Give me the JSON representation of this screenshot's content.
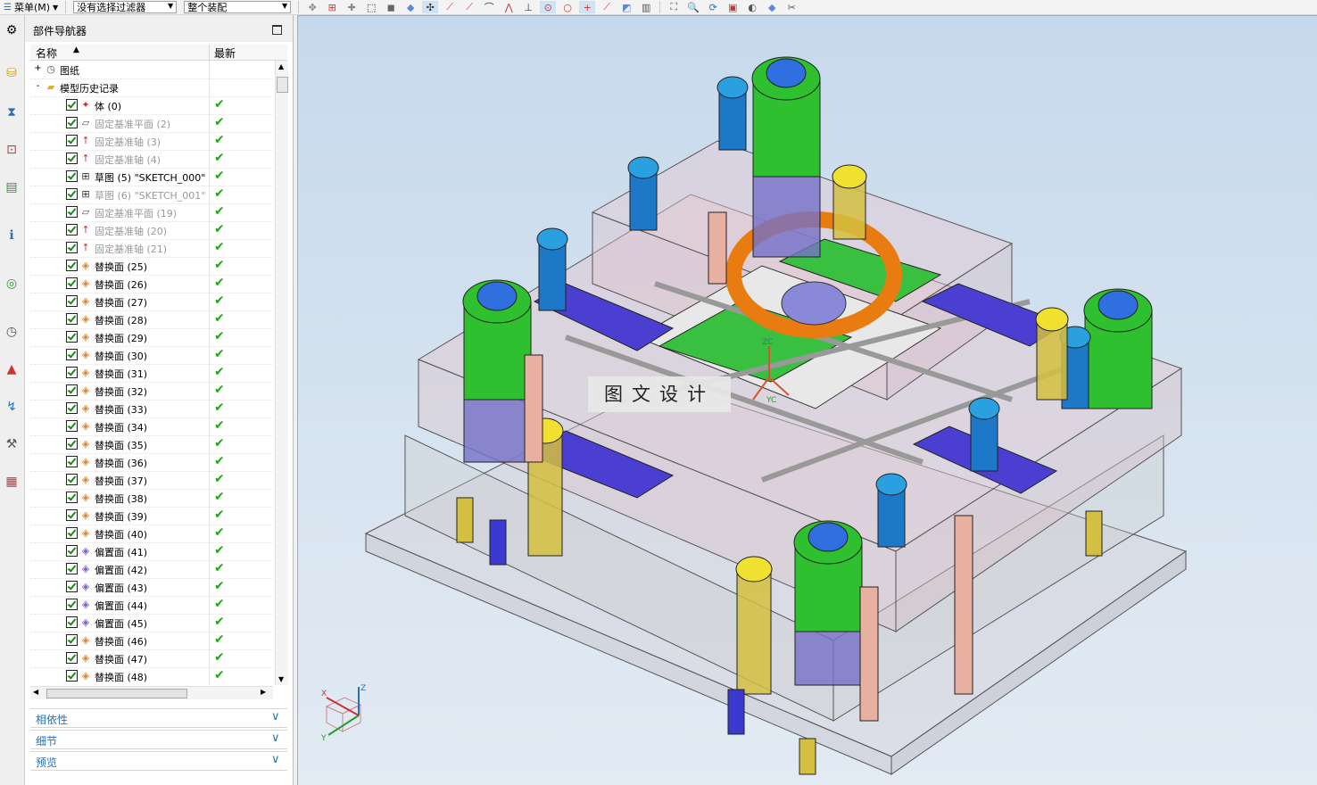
{
  "toolbar": {
    "menu_label": "菜单(M)",
    "filter_value": "没有选择过滤器",
    "scope_value": "整个装配"
  },
  "navigator": {
    "title": "部件导航器",
    "col_name": "名称",
    "col_latest": "最新",
    "tree": [
      {
        "label": "图纸",
        "level": 0,
        "expand": "+",
        "checked": false,
        "icon": "drawing-icon",
        "latest": false,
        "dim": false
      },
      {
        "label": "模型历史记录",
        "level": 0,
        "expand": "-",
        "checked": false,
        "icon": "folder-icon",
        "latest": false,
        "dim": false
      },
      {
        "label": "体 (0)",
        "level": 1,
        "checked": true,
        "icon": "body-icon",
        "latest": true,
        "dim": false
      },
      {
        "label": "固定基准平面 (2)",
        "level": 1,
        "checked": true,
        "icon": "datum-plane-icon",
        "latest": true,
        "dim": true
      },
      {
        "label": "固定基准轴 (3)",
        "level": 1,
        "checked": true,
        "icon": "datum-axis-icon",
        "latest": true,
        "dim": true
      },
      {
        "label": "固定基准轴 (4)",
        "level": 1,
        "checked": true,
        "icon": "datum-axis-icon",
        "latest": true,
        "dim": true
      },
      {
        "label": "草图 (5) \"SKETCH_000\"",
        "level": 1,
        "checked": true,
        "icon": "sketch-icon",
        "latest": true,
        "dim": false
      },
      {
        "label": "草图 (6) \"SKETCH_001\"",
        "level": 1,
        "checked": true,
        "icon": "sketch-icon",
        "latest": true,
        "dim": true
      },
      {
        "label": "固定基准平面 (19)",
        "level": 1,
        "checked": true,
        "icon": "datum-plane-icon",
        "latest": true,
        "dim": true
      },
      {
        "label": "固定基准轴 (20)",
        "level": 1,
        "checked": true,
        "icon": "datum-axis-icon",
        "latest": true,
        "dim": true
      },
      {
        "label": "固定基准轴 (21)",
        "level": 1,
        "checked": true,
        "icon": "datum-axis-icon",
        "latest": true,
        "dim": true
      },
      {
        "label": "替换面 (25)",
        "level": 1,
        "checked": true,
        "icon": "replace-face-icon",
        "latest": true,
        "dim": false
      },
      {
        "label": "替换面 (26)",
        "level": 1,
        "checked": true,
        "icon": "replace-face-icon",
        "latest": true,
        "dim": false
      },
      {
        "label": "替换面 (27)",
        "level": 1,
        "checked": true,
        "icon": "replace-face-icon",
        "latest": true,
        "dim": false
      },
      {
        "label": "替换面 (28)",
        "level": 1,
        "checked": true,
        "icon": "replace-face-icon",
        "latest": true,
        "dim": false
      },
      {
        "label": "替换面 (29)",
        "level": 1,
        "checked": true,
        "icon": "replace-face-icon",
        "latest": true,
        "dim": false
      },
      {
        "label": "替换面 (30)",
        "level": 1,
        "checked": true,
        "icon": "replace-face-icon",
        "latest": true,
        "dim": false
      },
      {
        "label": "替换面 (31)",
        "level": 1,
        "checked": true,
        "icon": "replace-face-icon",
        "latest": true,
        "dim": false
      },
      {
        "label": "替换面 (32)",
        "level": 1,
        "checked": true,
        "icon": "replace-face-icon",
        "latest": true,
        "dim": false
      },
      {
        "label": "替换面 (33)",
        "level": 1,
        "checked": true,
        "icon": "replace-face-icon",
        "latest": true,
        "dim": false
      },
      {
        "label": "替换面 (34)",
        "level": 1,
        "checked": true,
        "icon": "replace-face-icon",
        "latest": true,
        "dim": false
      },
      {
        "label": "替换面 (35)",
        "level": 1,
        "checked": true,
        "icon": "replace-face-icon",
        "latest": true,
        "dim": false
      },
      {
        "label": "替换面 (36)",
        "level": 1,
        "checked": true,
        "icon": "replace-face-icon",
        "latest": true,
        "dim": false
      },
      {
        "label": "替换面 (37)",
        "level": 1,
        "checked": true,
        "icon": "replace-face-icon",
        "latest": true,
        "dim": false
      },
      {
        "label": "替换面 (38)",
        "level": 1,
        "checked": true,
        "icon": "replace-face-icon",
        "latest": true,
        "dim": false
      },
      {
        "label": "替换面 (39)",
        "level": 1,
        "checked": true,
        "icon": "replace-face-icon",
        "latest": true,
        "dim": false
      },
      {
        "label": "替换面 (40)",
        "level": 1,
        "checked": true,
        "icon": "replace-face-icon",
        "latest": true,
        "dim": false
      },
      {
        "label": "偏置面 (41)",
        "level": 1,
        "checked": true,
        "icon": "offset-face-icon",
        "latest": true,
        "dim": false
      },
      {
        "label": "偏置面 (42)",
        "level": 1,
        "checked": true,
        "icon": "offset-face-icon",
        "latest": true,
        "dim": false
      },
      {
        "label": "偏置面 (43)",
        "level": 1,
        "checked": true,
        "icon": "offset-face-icon",
        "latest": true,
        "dim": false
      },
      {
        "label": "偏置面 (44)",
        "level": 1,
        "checked": true,
        "icon": "offset-face-icon",
        "latest": true,
        "dim": false
      },
      {
        "label": "偏置面 (45)",
        "level": 1,
        "checked": true,
        "icon": "offset-face-icon",
        "latest": true,
        "dim": false
      },
      {
        "label": "替换面 (46)",
        "level": 1,
        "checked": true,
        "icon": "replace-face-icon",
        "latest": true,
        "dim": false
      },
      {
        "label": "替换面 (47)",
        "level": 1,
        "checked": true,
        "icon": "replace-face-icon",
        "latest": true,
        "dim": false
      },
      {
        "label": "替换面 (48)",
        "level": 1,
        "checked": true,
        "icon": "replace-face-icon",
        "latest": true,
        "dim": false
      }
    ],
    "panels": [
      "相依性",
      "细节",
      "预览"
    ]
  },
  "viewport": {
    "watermark": "图文设计",
    "axis_labels": {
      "x": "X",
      "y": "Y",
      "z": "Z",
      "yc": "YC",
      "zc": "ZC"
    }
  },
  "colors": {
    "accent_blue": "#2a70b8",
    "check_green": "#1ea81e",
    "viewport_border": "#f09a60"
  }
}
